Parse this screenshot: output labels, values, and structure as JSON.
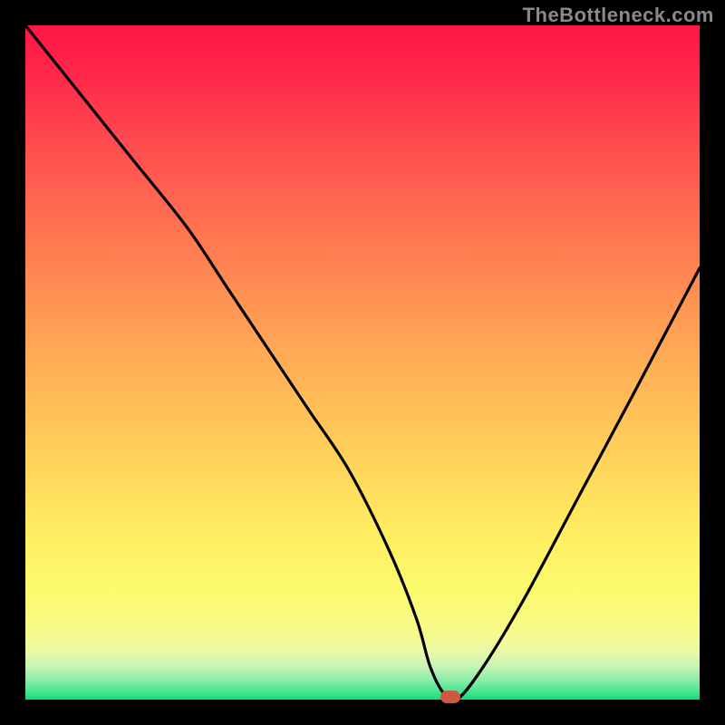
{
  "watermark": "TheBottleneck.com",
  "colors": {
    "background": "#000000",
    "curve": "#000000",
    "marker": "#cf593f",
    "gradient_top": "#ff1646",
    "gradient_bottom": "#15db7a"
  },
  "chart_data": {
    "type": "line",
    "title": "",
    "xlabel": "",
    "ylabel": "",
    "xlim": [
      0,
      100
    ],
    "ylim": [
      0,
      100
    ],
    "grid": false,
    "series": [
      {
        "name": "bottleneck-curve",
        "x": [
          0,
          8,
          16,
          24,
          30,
          36,
          42,
          48,
          54,
          58,
          60,
          62,
          64,
          68,
          74,
          82,
          90,
          100
        ],
        "values": [
          100,
          90,
          80,
          70,
          61,
          52,
          43,
          34,
          22,
          12,
          5,
          1,
          0,
          5,
          15,
          30,
          45,
          64
        ]
      }
    ],
    "annotations": [
      {
        "name": "minimum-marker",
        "x": 63,
        "y": 0
      }
    ]
  }
}
